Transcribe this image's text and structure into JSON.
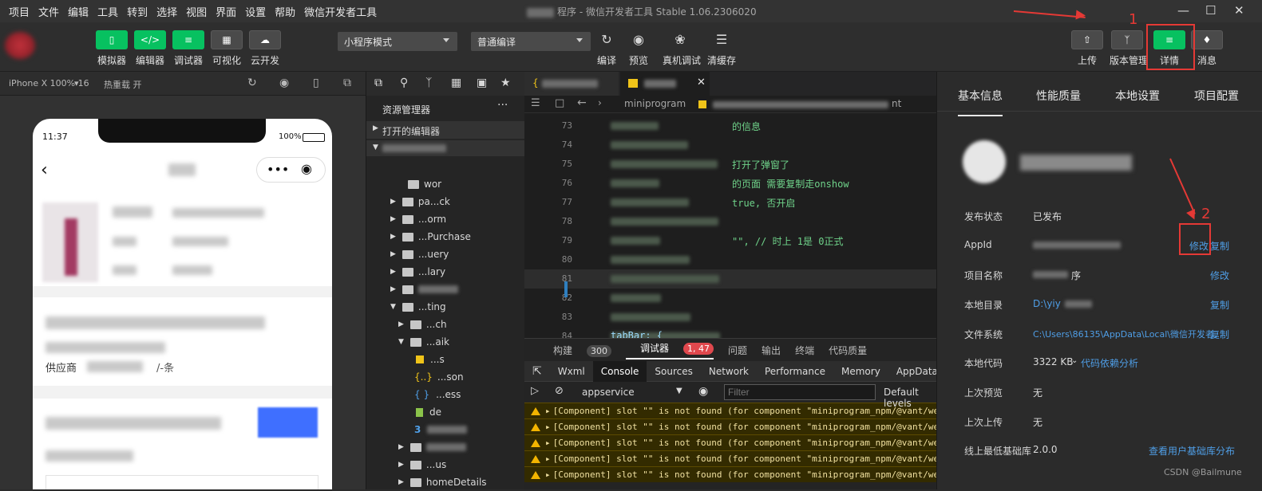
{
  "menubar": {
    "items": [
      "项目",
      "文件",
      "编辑",
      "工具",
      "转到",
      "选择",
      "视图",
      "界面",
      "设置",
      "帮助",
      "微信开发者工具"
    ],
    "title": "程序 - 微信开发者工具 Stable 1.06.2306020"
  },
  "toolbar": {
    "left_buttons": [
      "模拟器",
      "编辑器",
      "调试器",
      "可视化",
      "云开发"
    ],
    "mode_select": "小程序模式",
    "compile_select": "普通编译",
    "mid_buttons": [
      "编译",
      "预览",
      "真机调试",
      "清缓存"
    ],
    "right_buttons": [
      "上传",
      "版本管理",
      "详情",
      "消息"
    ]
  },
  "simulator": {
    "device": "iPhone X 100% 16",
    "hot_reload": "热重载 开",
    "time": "11:37",
    "battery": "100%",
    "supplier_text": "供应商",
    "supplier_suffix": "/-条"
  },
  "explorer": {
    "title": "资源管理器",
    "open_editors": "打开的编辑器",
    "items": [
      "wor",
      "pa...ck",
      "...orm",
      "...Purchase",
      "...uery",
      "...lary",
      "",
      "...ting",
      "...ch",
      "...aik",
      "...s",
      "...son",
      "...ess",
      "de",
      "",
      "",
      "...us",
      "homeDetails"
    ]
  },
  "editor": {
    "breadcrumb": "miniprogram",
    "breadcrumb_tail": "nt",
    "lines": [
      {
        "n": "73",
        "t": "的信息"
      },
      {
        "n": "74",
        "t": ""
      },
      {
        "n": "75",
        "t": "打开了弹窗了"
      },
      {
        "n": "76",
        "t": "的页面  需要复制走onshow"
      },
      {
        "n": "77",
        "t": "true,    否开启"
      },
      {
        "n": "78",
        "t": ""
      },
      {
        "n": "79",
        "t": "\"\", //     时上 1是  0正式"
      },
      {
        "n": "80",
        "t": ""
      },
      {
        "n": "81",
        "t": ""
      },
      {
        "n": "82",
        "t": ""
      },
      {
        "n": "83",
        "t": ""
      },
      {
        "n": "84",
        "t": "tabBar: {"
      }
    ]
  },
  "console": {
    "top_tabs": [
      {
        "label": "构建",
        "badge": "300"
      },
      {
        "label": "调试器",
        "badge": "1, 47"
      },
      {
        "label": "问题"
      },
      {
        "label": "输出"
      },
      {
        "label": "终端"
      },
      {
        "label": "代码质量"
      }
    ],
    "devtools_tabs": [
      "Wxml",
      "Console",
      "Sources",
      "Network",
      "Performance",
      "Memory",
      "AppData"
    ],
    "context": "appservice",
    "filter_placeholder": "Filter",
    "levels": "Default levels",
    "warning": "[Component] slot \"\" is not found (for component \"miniprogram_npm/@vant/wea"
  },
  "details": {
    "tabs": [
      "基本信息",
      "性能质量",
      "本地设置",
      "项目配置"
    ],
    "rows": [
      {
        "label": "发布状态",
        "value": "已发布"
      },
      {
        "label": "AppId",
        "value": "",
        "actions": [
          "修改",
          "复制"
        ]
      },
      {
        "label": "项目名称",
        "value": "序",
        "actions": [
          "修改"
        ]
      },
      {
        "label": "本地目录",
        "value": "D:\\yiy",
        "actions": [
          "复制"
        ]
      },
      {
        "label": "文件系统",
        "value": "C:\\Users\\86135\\AppData\\Local\\微信开发者...",
        "actions": [
          "复制"
        ]
      },
      {
        "label": "本地代码",
        "value": "3322 KB",
        "extra": "代码依赖分析"
      },
      {
        "label": "上次预览",
        "value": "无"
      },
      {
        "label": "上次上传",
        "value": "无"
      },
      {
        "label": "线上最低基础库",
        "value": "2.0.0",
        "extra": "查看用户基础库分布"
      }
    ],
    "watermark": "CSDN @Bailmune"
  },
  "annotations": [
    "1",
    "2"
  ]
}
